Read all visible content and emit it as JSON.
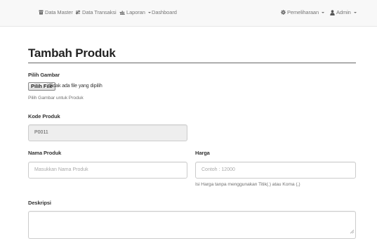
{
  "navbar": {
    "data_master": "Data Master",
    "data_transaksi": "Data Transaksi",
    "laporan": "Laporan",
    "dashboard": "Dashboard",
    "pemeliharaan": "Pemeliharaan",
    "admin": "Admin"
  },
  "form": {
    "title": "Tambah Produk",
    "gambar": {
      "label": "Pilih Gambar",
      "button": "Pilih File",
      "status": "Tidak ada file yang dipilih",
      "help": "Pilih Gambar untuk Produk"
    },
    "kode": {
      "label": "Kode Produk",
      "value": "P0011"
    },
    "nama": {
      "label": "Nama Produk",
      "placeholder": "Masukkan Nama Produk"
    },
    "harga": {
      "label": "Harga",
      "placeholder": "Contoh : 12000",
      "help": "Isi Harga tanpa menggunakan Titik(.) atau Koma (,)"
    },
    "deskripsi": {
      "label": "Deskripsi",
      "value": ""
    }
  },
  "icons": {
    "data_master": "archive-icon",
    "data_transaksi": "transfer-icon",
    "laporan": "bar-chart-icon",
    "pemeliharaan": "gear-icon",
    "admin": "user-icon"
  }
}
